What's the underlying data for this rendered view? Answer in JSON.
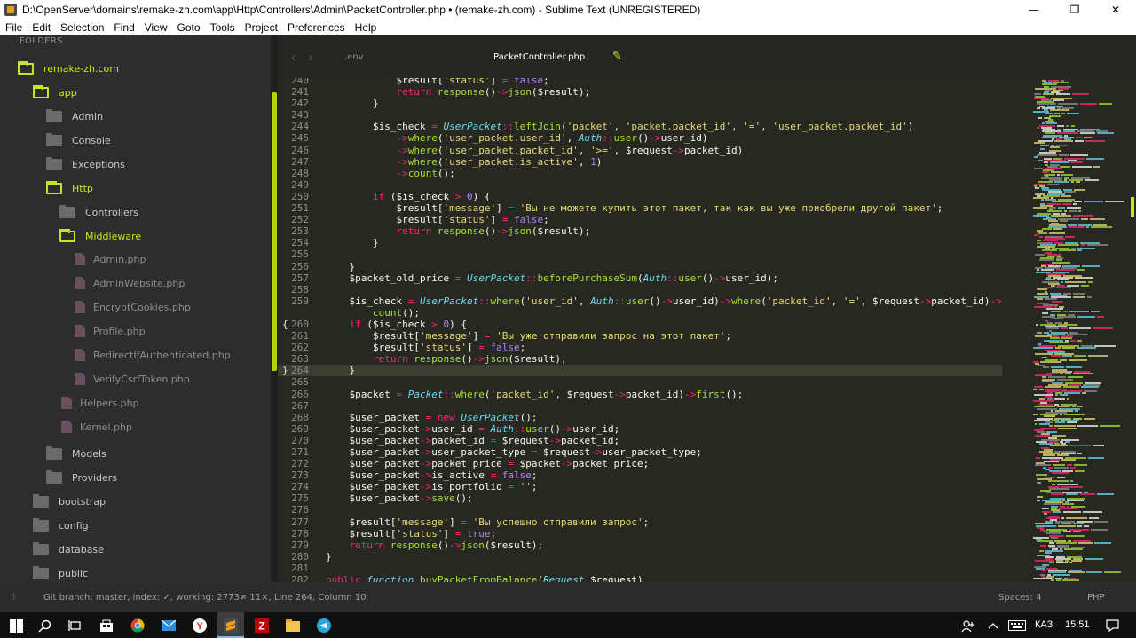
{
  "window": {
    "title": "D:\\OpenServer\\domains\\remake-zh.com\\app\\Http\\Controllers\\Admin\\PacketController.php • (remake-zh.com) - Sublime Text (UNREGISTERED)",
    "controls": {
      "minimize": "—",
      "maximize": "❐",
      "close": "✕"
    }
  },
  "menu": [
    "File",
    "Edit",
    "Selection",
    "Find",
    "View",
    "Goto",
    "Tools",
    "Project",
    "Preferences",
    "Help"
  ],
  "sidebar": {
    "header": "FOLDERS",
    "items": [
      {
        "label": "remake-zh.com",
        "type": "folder-open"
      },
      {
        "label": "app",
        "type": "folder-open"
      },
      {
        "label": "Admin",
        "type": "folder"
      },
      {
        "label": "Console",
        "type": "folder"
      },
      {
        "label": "Exceptions",
        "type": "folder"
      },
      {
        "label": "Http",
        "type": "folder-open"
      },
      {
        "label": "Controllers",
        "type": "folder"
      },
      {
        "label": "Middleware",
        "type": "folder-open"
      },
      {
        "label": "Admin.php",
        "type": "file"
      },
      {
        "label": "AdminWebsite.php",
        "type": "file"
      },
      {
        "label": "EncryptCookies.php",
        "type": "file"
      },
      {
        "label": "Profile.php",
        "type": "file"
      },
      {
        "label": "RedirectIfAuthenticated.php",
        "type": "file"
      },
      {
        "label": "VerifyCsrfToken.php",
        "type": "file"
      },
      {
        "label": "Helpers.php",
        "type": "file"
      },
      {
        "label": "Kernel.php",
        "type": "file"
      },
      {
        "label": "Models",
        "type": "folder"
      },
      {
        "label": "Providers",
        "type": "folder"
      },
      {
        "label": "bootstrap",
        "type": "folder"
      },
      {
        "label": "config",
        "type": "folder"
      },
      {
        "label": "database",
        "type": "folder"
      },
      {
        "label": "public",
        "type": "folder"
      }
    ]
  },
  "tabs": [
    {
      "label": ".env",
      "active": false
    },
    {
      "label": "PacketController.php",
      "active": true
    }
  ],
  "editor": {
    "current_line": 264,
    "lines": [
      {
        "n": "240",
        "text": "            $result['status'] = false;"
      },
      {
        "n": "241",
        "text": "            return response()->json($result);"
      },
      {
        "n": "242",
        "text": "        }"
      },
      {
        "n": "243",
        "text": ""
      },
      {
        "n": "244",
        "text": "        $is_check = UserPacket::leftJoin('packet', 'packet.packet_id', '=', 'user_packet.packet_id')"
      },
      {
        "n": "245",
        "text": "            ->where('user_packet.user_id', Auth::user()->user_id)"
      },
      {
        "n": "246",
        "text": "            ->where('user_packet.packet_id', '>=', $request->packet_id)"
      },
      {
        "n": "247",
        "text": "            ->where('user_packet.is_active', 1)"
      },
      {
        "n": "248",
        "text": "            ->count();"
      },
      {
        "n": "249",
        "text": ""
      },
      {
        "n": "250",
        "text": "        if ($is_check > 0) {"
      },
      {
        "n": "251",
        "text": "            $result['message'] = 'Вы не можете купить этот пакет, так как вы уже приобрели другой пакет';"
      },
      {
        "n": "252",
        "text": "            $result['status'] = false;"
      },
      {
        "n": "253",
        "text": "            return response()->json($result);"
      },
      {
        "n": "254",
        "text": "        }"
      },
      {
        "n": "255",
        "text": ""
      },
      {
        "n": "256",
        "text": "    }"
      },
      {
        "n": "257",
        "text": "    $packet_old_price = UserPacket::beforePurchaseSum(Auth::user()->user_id);"
      },
      {
        "n": "258",
        "text": ""
      },
      {
        "n": "259",
        "text": "    $is_check = UserPacket::where('user_id', Auth::user()->user_id)->where('packet_id', '=', $request->packet_id)->"
      },
      {
        "n": "",
        "text": "        count();"
      },
      {
        "n": "260",
        "text": "    if ($is_check > 0) {"
      },
      {
        "n": "261",
        "text": "        $result['message'] = 'Вы уже отправили запрос на этот пакет';"
      },
      {
        "n": "262",
        "text": "        $result['status'] = false;"
      },
      {
        "n": "263",
        "text": "        return response()->json($result);"
      },
      {
        "n": "264",
        "text": "    }"
      },
      {
        "n": "265",
        "text": ""
      },
      {
        "n": "266",
        "text": "    $packet = Packet::where('packet_id', $request->packet_id)->first();"
      },
      {
        "n": "267",
        "text": ""
      },
      {
        "n": "268",
        "text": "    $user_packet = new UserPacket();"
      },
      {
        "n": "269",
        "text": "    $user_packet->user_id = Auth::user()->user_id;"
      },
      {
        "n": "270",
        "text": "    $user_packet->packet_id = $request->packet_id;"
      },
      {
        "n": "271",
        "text": "    $user_packet->user_packet_type = $request->user_packet_type;"
      },
      {
        "n": "272",
        "text": "    $user_packet->packet_price = $packet->packet_price;"
      },
      {
        "n": "273",
        "text": "    $user_packet->is_active = false;"
      },
      {
        "n": "274",
        "text": "    $user_packet->is_portfolio = '';"
      },
      {
        "n": "275",
        "text": "    $user_packet->save();"
      },
      {
        "n": "276",
        "text": ""
      },
      {
        "n": "277",
        "text": "    $result['message'] = 'Вы успешно отправили запрос';"
      },
      {
        "n": "278",
        "text": "    $result['status'] = true;"
      },
      {
        "n": "279",
        "text": "    return response()->json($result);"
      },
      {
        "n": "280",
        "text": "}"
      },
      {
        "n": "281",
        "text": ""
      },
      {
        "n": "282",
        "text": "public function buyPacketFromBalance(Request $request)"
      }
    ]
  },
  "statusbar": {
    "left": "Git branch: master, index: ✓, working: 2773≠ 11×, Line 264, Column 10",
    "spaces": "Spaces: 4",
    "syntax": "PHP"
  },
  "taskbar": {
    "language": "КАЗ",
    "time": "15:51"
  },
  "colors": {
    "accent": "#c7e622",
    "editor_bg": "#272822",
    "sidebar_bg": "#2d2d2d",
    "keyword": "#f92672",
    "string": "#e6db74",
    "function": "#a6e22e",
    "class": "#66d9ef"
  }
}
